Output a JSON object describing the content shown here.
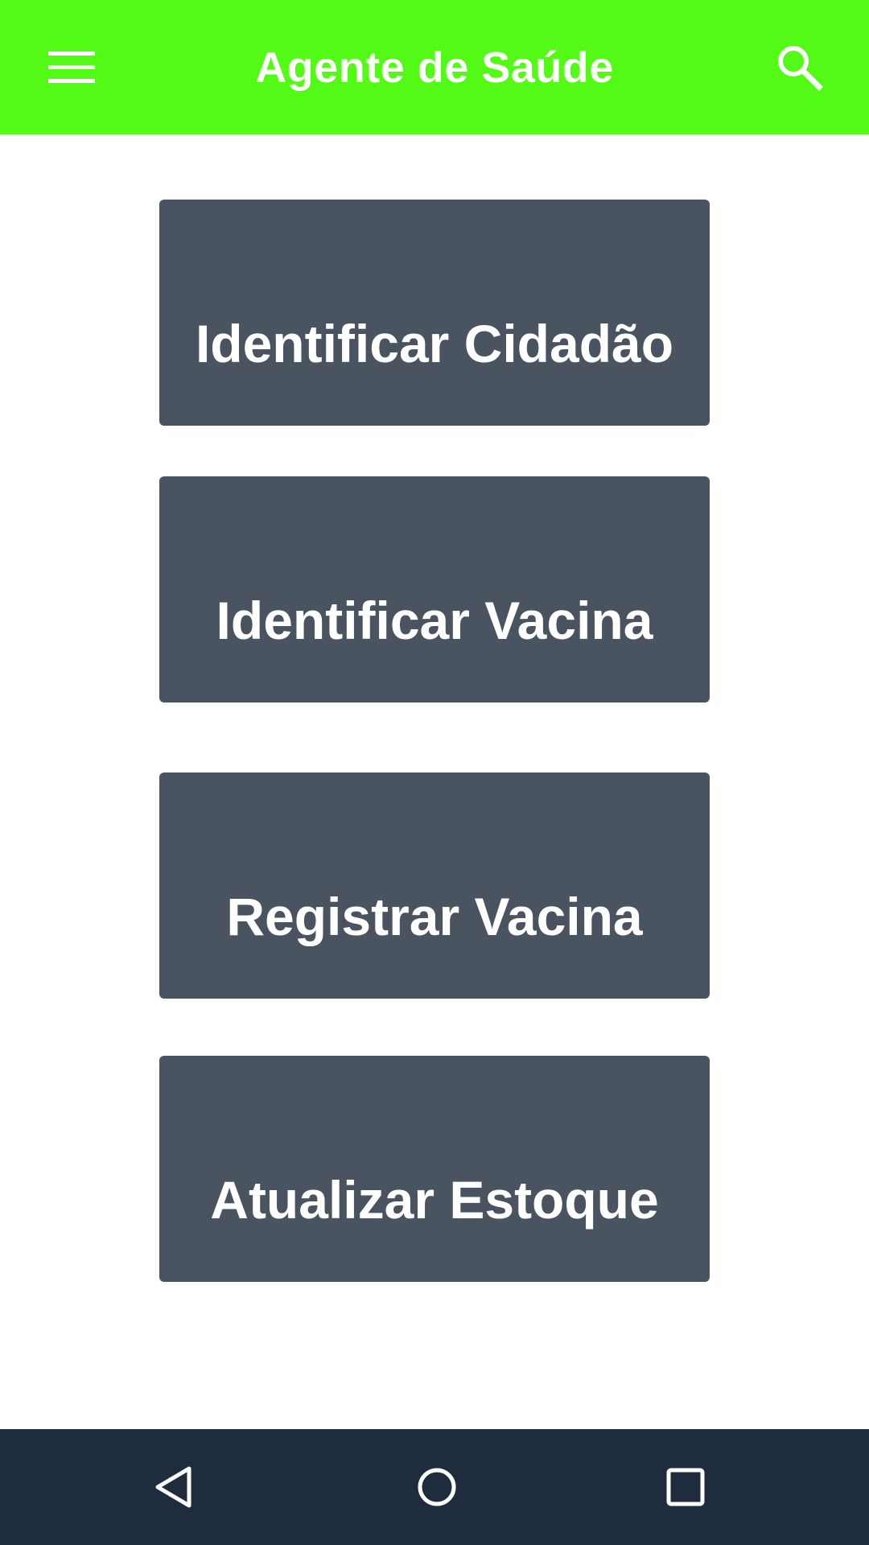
{
  "app_bar": {
    "title": "Agente de Saúde",
    "background_color": "#52fa16",
    "menu_icon": "hamburger-menu-icon",
    "search_icon": "search-icon"
  },
  "actions": [
    {
      "label": "Identificar Cidadão"
    },
    {
      "label": "Identificar Vacina"
    },
    {
      "label": "Registrar Vacina"
    },
    {
      "label": "Atualizar Estoque"
    }
  ],
  "button_color": "#4a5360",
  "nav_bar": {
    "background_color": "#1f2c3e",
    "icons": [
      "back-icon",
      "home-icon",
      "recents-icon"
    ]
  }
}
